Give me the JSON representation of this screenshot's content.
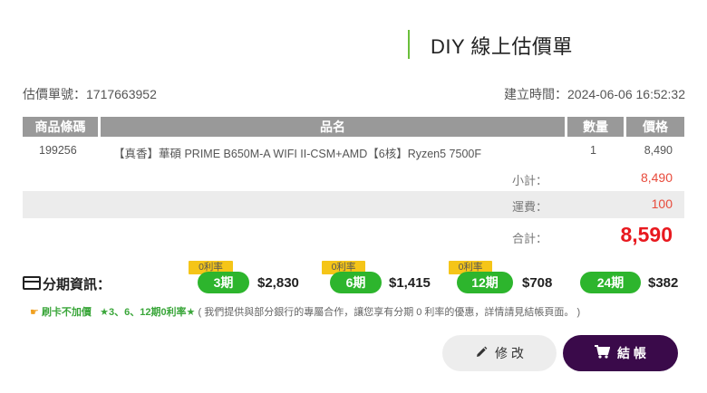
{
  "header": {
    "title": "DIY 線上估價單"
  },
  "meta": {
    "quote_label": "估價單號：",
    "quote_no": "1717663952",
    "created_label": "建立時間：",
    "created_at": "2024-06-06 16:52:32"
  },
  "table": {
    "headers": [
      "商品條碼",
      "品名",
      "數量",
      "價格"
    ],
    "rows": [
      {
        "barcode": "199256",
        "name": "【真香】華碩 PRIME B650M-A WIFI II-CSM+AMD【6核】Ryzen5 7500F",
        "qty": "1",
        "price": "8,490"
      }
    ]
  },
  "summary": {
    "subtotal_label": "小計：",
    "subtotal": "8,490",
    "shipping_label": "運費：",
    "shipping": "100",
    "total_label": "合計：",
    "total": "8,590"
  },
  "installment": {
    "label": "分期資訊：",
    "plans": [
      {
        "badge": "0利率",
        "period": "3期",
        "amount": "$2,830"
      },
      {
        "badge": "0利率",
        "period": "6期",
        "amount": "$1,415"
      },
      {
        "badge": "0利率",
        "period": "12期",
        "amount": "$708"
      },
      {
        "badge": "",
        "period": "24期",
        "amount": "$382"
      }
    ],
    "note_a": "刷卡不加價",
    "note_b": "★3、6、12期0利率★",
    "note_c": "( 我們提供與部分銀行的專屬合作，讓您享有分期 0 利率的優惠，詳情請見結帳頁面。 )"
  },
  "actions": {
    "edit_label": "修 改",
    "checkout_label": "結 帳"
  },
  "colors": {
    "accent_green": "#2db52d",
    "badge_yellow": "#f5c518",
    "price_red": "#e8191f",
    "checkout_bg": "#3a0a4a"
  },
  "icons": [
    "credit-card-icon",
    "pointing-hand-icon",
    "pencil-icon",
    "cart-icon"
  ]
}
